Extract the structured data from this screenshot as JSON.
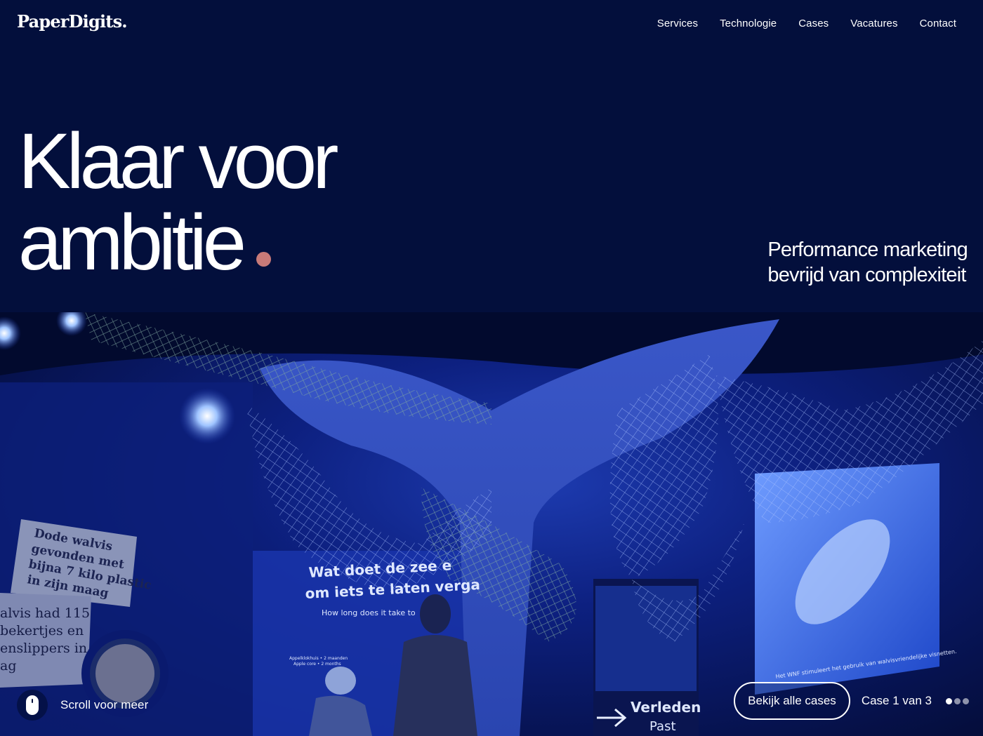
{
  "header": {
    "logo": "PaperDigits.",
    "nav": [
      "Services",
      "Technologie",
      "Cases",
      "Vacatures",
      "Contact"
    ]
  },
  "hero": {
    "title_line1": "Klaar voor",
    "title_line2": "ambitie",
    "tagline_line1": "Performance marketing",
    "tagline_line2": "bevrijd van complexiteit"
  },
  "photo": {
    "news_clip1": [
      "Dode walvis",
      "gevonden met",
      "bijna 7 kilo plastic",
      "in zijn maag"
    ],
    "news_clip2": [
      "alvis had 115",
      "bekertjes en",
      "enslippers in",
      "ag"
    ],
    "banner_line1": "Wat doet de zee e",
    "banner_line2": "om iets te laten verga",
    "banner_line3": "How long does it take to",
    "banner_small1": "Appelklokhuis • 2 maanden",
    "banner_small2": "Apple core • 2 months",
    "sign_big": "Verleden",
    "sign_small": "Past",
    "screen_caption": "Het WNF stimuleert het gebruik van walvisvriendelijke visnetten."
  },
  "footer": {
    "scroll_text": "Scroll voor meer",
    "cases_button": "Bekijk alle cases",
    "case_counter": "Case 1 van 3",
    "active_case": 1,
    "total_cases": 3
  },
  "colors": {
    "background": "#030f3c",
    "accent_dot": "#c87a78"
  }
}
